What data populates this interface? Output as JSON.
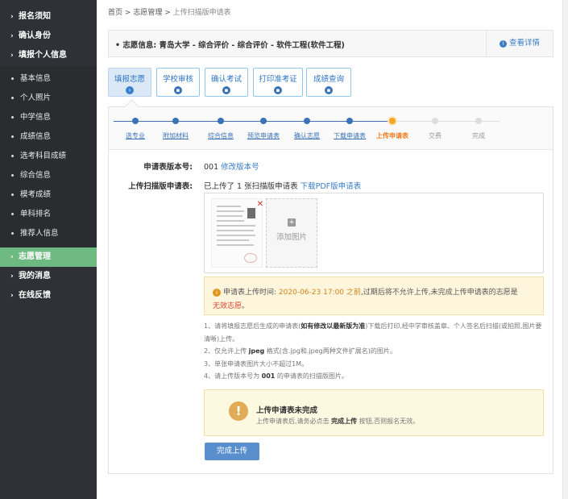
{
  "sidebar": {
    "top_items": [
      {
        "label": "报名须知"
      },
      {
        "label": "确认身份"
      },
      {
        "label": "填报个人信息"
      }
    ],
    "sub_items": [
      {
        "label": "基本信息"
      },
      {
        "label": "个人照片"
      },
      {
        "label": "中学信息"
      },
      {
        "label": "成绩信息"
      },
      {
        "label": "选考科目成绩"
      },
      {
        "label": "综合信息"
      },
      {
        "label": "模考成绩"
      },
      {
        "label": "单科排名"
      },
      {
        "label": "推荐人信息"
      }
    ],
    "bottom_items": [
      {
        "label": "志愿管理",
        "active": true
      },
      {
        "label": "我的消息"
      },
      {
        "label": "在线反馈"
      }
    ]
  },
  "breadcrumb": {
    "home": "首页",
    "sep1": ">",
    "section": "志愿管理",
    "sep2": ">",
    "current": "上传扫描版申请表"
  },
  "info": {
    "prefix": "志愿信息:",
    "value": "青岛大学 - 综合评价 - 综合评价 - 软件工程(软件工程)",
    "detail_label": "查看详情"
  },
  "tabs": [
    {
      "label": "填报志愿",
      "active": true
    },
    {
      "label": "学校审核"
    },
    {
      "label": "确认考试"
    },
    {
      "label": "打印准考证"
    },
    {
      "label": "成绩查询"
    }
  ],
  "steps": [
    {
      "label": "选专业",
      "state": "done"
    },
    {
      "label": "附加材料",
      "state": "done"
    },
    {
      "label": "综合信息",
      "state": "done"
    },
    {
      "label": "预览申请表",
      "state": "done"
    },
    {
      "label": "确认志愿",
      "state": "done"
    },
    {
      "label": "下载申请表",
      "state": "done"
    },
    {
      "label": "上传申请表",
      "state": "current"
    },
    {
      "label": "交费",
      "state": "todo"
    },
    {
      "label": "完成",
      "state": "todo"
    }
  ],
  "form": {
    "version_label": "申请表版本号:",
    "version_value": "001",
    "version_link": "修改版本号",
    "upload_label": "上传扫描版申请表:",
    "upload_status": "已上传了 1 张扫描版申请表",
    "download_link": "下载PDF版申请表",
    "add_image": "添加图片"
  },
  "warning": {
    "prefix": "申请表上传时间:",
    "time": "2020-06-23 17:00 之前",
    "mid": ",过期后将不允许上传,未完成上传申请表的志愿是",
    "tail_red": "无效志愿",
    "end": "。"
  },
  "notes": {
    "n1a": "1、请将填报志愿后生成的申请表(",
    "n1b": "如有修改以最新版为准",
    "n1c": ")下载后打印,经中学审核盖章、个人签名后扫描(或拍照,图片要清晰)上传。",
    "n2a": "2、仅允许上传 ",
    "n2b": "jpeg",
    "n2c": " 格式(含.jpg和.jpeg两种文件扩展名)的图片。",
    "n3": "3、单张申请表图片大小不超过1M。",
    "n4a": "4、请上传版本号为 ",
    "n4b": "001",
    "n4c": " 的申请表的扫描版图片。"
  },
  "incomplete": {
    "title": "上传申请表未完成",
    "desc_a": "上传申请表后,请务必点击 ",
    "desc_b": "完成上传",
    "desc_c": " 按钮,否则报名无效。"
  },
  "finish_button": "完成上传"
}
